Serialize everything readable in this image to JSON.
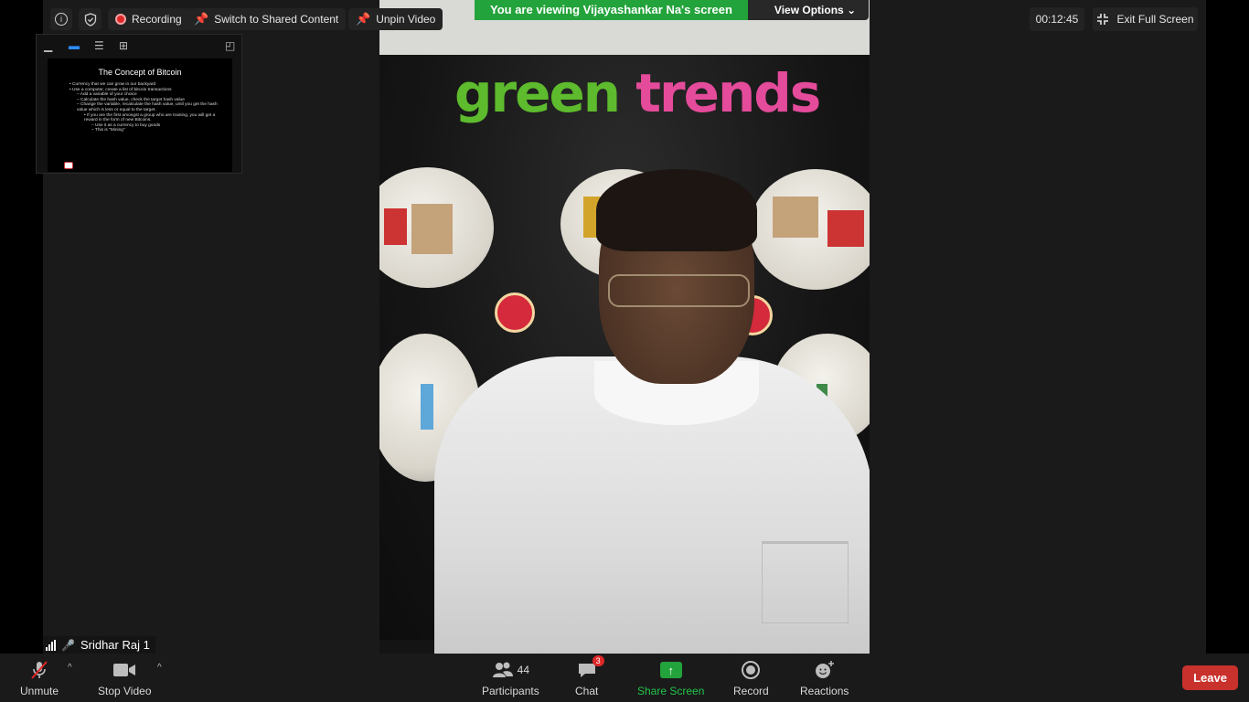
{
  "window": {
    "viewing_banner": "You are viewing Vijayashankar Na's screen",
    "view_options_label": "View Options",
    "timer": "00:12:45",
    "exit_fullscreen_label": "Exit Full Screen"
  },
  "topbar": {
    "recording_label": "Recording",
    "switch_shared_label": "Switch to Shared Content",
    "unpin_label": "Unpin Video"
  },
  "thumbnail": {
    "slide_title": "The Concept of Bitcoin",
    "bullets": [
      "Currency that we can grow in our backyard",
      "Use a computer, create a list of bitcoin transactions",
      "Add a variable of your choice",
      "Calculate the hash value, check the target hash value",
      "Change the variable, recalculate the hash value, until you get the hash value which is less or equal to the target.",
      "If you are the first amongst a group who are training, you will get a reward in the form of new Bitcoins.",
      "Use it as a currency to buy goods",
      "This is \"Mining\""
    ]
  },
  "video": {
    "brand_green": "green",
    "brand_pink": "trends",
    "participant_name": "Sridhar Raj 1"
  },
  "toolbar": {
    "unmute_label": "Unmute",
    "stop_video_label": "Stop Video",
    "participants_label": "Participants",
    "participants_count": "44",
    "chat_label": "Chat",
    "chat_badge": "3",
    "share_screen_label": "Share Screen",
    "record_label": "Record",
    "reactions_label": "Reactions",
    "leave_label": "Leave"
  },
  "colors": {
    "share_green": "#23a33b",
    "leave_red": "#c9312c",
    "accent_blue": "#2d8cff"
  }
}
